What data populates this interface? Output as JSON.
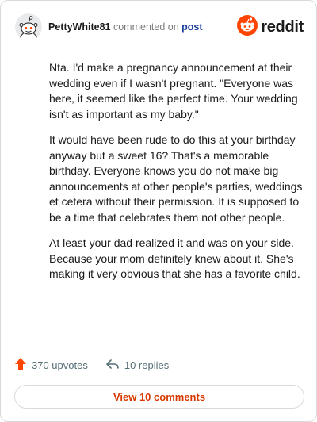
{
  "header": {
    "username": "PettyWhite81",
    "action_text": "commented on",
    "post_link": "post",
    "brand": "reddit"
  },
  "comment": {
    "paragraphs": [
      "Nta. I'd make a pregnancy announcement at their wedding even if I wasn't pregnant. \"Everyone was here, it seemed like the perfect time. Your wedding isn't as important as my baby.\"",
      "It would have been rude to do this at your birthday anyway but a sweet 16? That's a memorable birthday. Everyone knows you do not make big announcements at other people's parties, weddings et cetera without their permission. It is supposed to be a time that celebrates them not other people.",
      "At least your dad realized it and was on your side. Because your mom definitely knew about it. She's making it very obvious that she has a favorite child."
    ]
  },
  "actions": {
    "upvotes": "370 upvotes",
    "replies": "10 replies"
  },
  "footer": {
    "view_comments": "View 10 comments"
  },
  "colors": {
    "brand_orange": "#ff4500",
    "link_blue": "#1a3f9c",
    "button_text": "#d93900"
  },
  "icons": {
    "avatar": "snoo-avatar",
    "brand": "reddit-logo-icon",
    "upvote": "upvote-arrow-icon",
    "reply": "reply-arrow-icon"
  }
}
